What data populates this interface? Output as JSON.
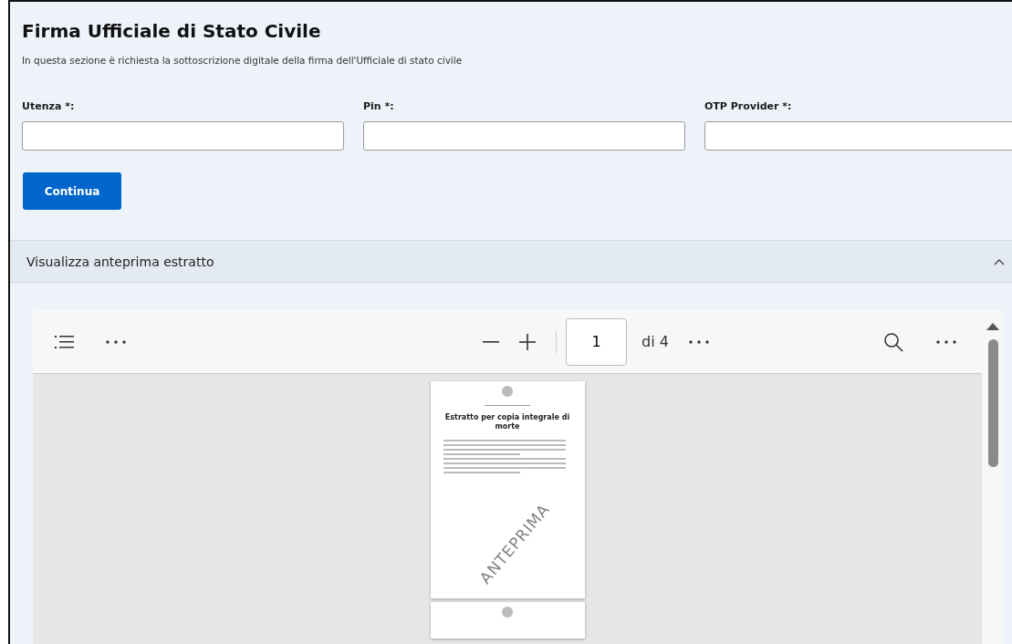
{
  "title": "Firma Ufficiale di Stato Civile",
  "description": "In questa sezione è richiesta la sottoscrizione digitale della firma dell'Ufficiale di stato civile",
  "fields": [
    {
      "label": "Utenza *:"
    },
    {
      "label": "Pin *:"
    },
    {
      "label": "OTP Provider *:"
    }
  ],
  "button": "Continua",
  "accordion": {
    "title": "Visualizza anteprima estratto",
    "expanded": true
  },
  "viewer": {
    "page": "1",
    "total": "di 4",
    "document": {
      "heading": "Estratto per copia integrale di morte",
      "watermark": "ANTEPRIMA"
    }
  }
}
